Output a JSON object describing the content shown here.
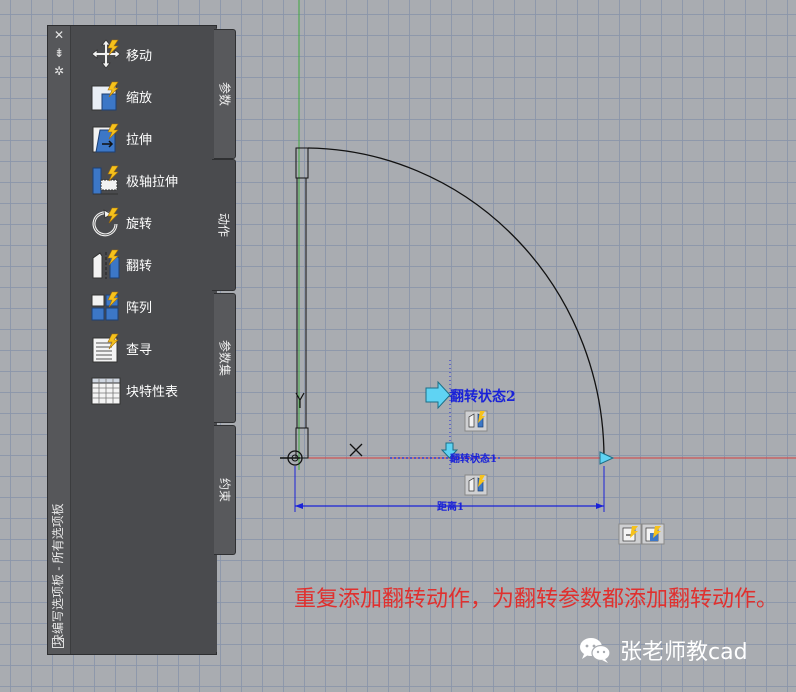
{
  "palette": {
    "title": "块编写选项板 - 所有选项板",
    "tools": [
      {
        "label": "移动",
        "icon": "move-icon"
      },
      {
        "label": "缩放",
        "icon": "scale-icon"
      },
      {
        "label": "拉伸",
        "icon": "stretch-icon"
      },
      {
        "label": "极轴拉伸",
        "icon": "polar-stretch-icon"
      },
      {
        "label": "旋转",
        "icon": "rotate-icon"
      },
      {
        "label": "翻转",
        "icon": "flip-icon"
      },
      {
        "label": "阵列",
        "icon": "array-icon"
      },
      {
        "label": "查寻",
        "icon": "lookup-icon"
      },
      {
        "label": "块特性表",
        "icon": "block-table-icon"
      }
    ],
    "tabs": [
      {
        "label": "参数",
        "active": false
      },
      {
        "label": "动作",
        "active": true
      },
      {
        "label": "参数集",
        "active": false
      },
      {
        "label": "约束",
        "active": false
      }
    ]
  },
  "drawing": {
    "flip_state_2": "翻转状态2",
    "flip_state_1": "翻转状态1",
    "distance_label": "距离1",
    "colors": {
      "dimension": "#1a22d8",
      "grip": "#5fd3f3",
      "axis_x": "#d84040",
      "axis_y": "#3ea83e",
      "line": "#111111"
    }
  },
  "caption": "重复添加翻转动作，为翻转参数都添加翻转动作。",
  "watermark": "张老师教cad"
}
